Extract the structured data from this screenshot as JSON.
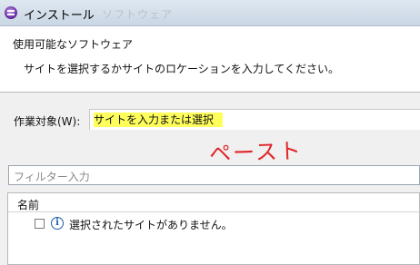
{
  "window": {
    "title": "インストール",
    "ghost_title": "ソフトウェア"
  },
  "header": {
    "title": "使用可能なソフトウェア",
    "message": "サイトを選択するかサイトのロケーションを入力してください。"
  },
  "work_with": {
    "label": "作業対象(W):",
    "placeholder": "サイトを入力または選択",
    "highlight_color": "#ffff5c"
  },
  "annotation": {
    "text": "ペースト",
    "color": "#e0262a"
  },
  "filter": {
    "placeholder": "フィルター入力"
  },
  "table": {
    "columns": [
      "名前"
    ],
    "rows": [
      {
        "checked": false,
        "icon": "info-icon",
        "text": "選択されたサイトがありません。"
      }
    ]
  }
}
